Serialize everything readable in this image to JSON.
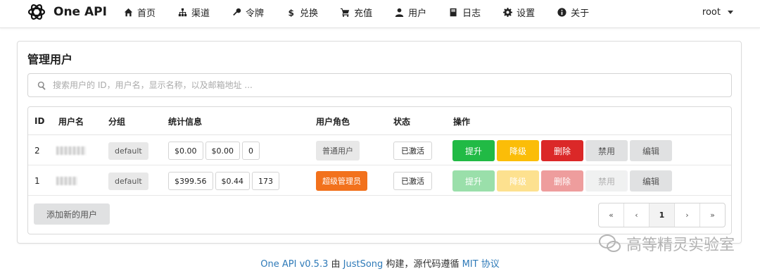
{
  "app": {
    "name": "One API"
  },
  "nav": {
    "items": [
      {
        "label": "首页",
        "icon": "home-icon"
      },
      {
        "label": "渠道",
        "icon": "sitemap-icon"
      },
      {
        "label": "令牌",
        "icon": "key-icon"
      },
      {
        "label": "兑换",
        "icon": "dollar-icon"
      },
      {
        "label": "充值",
        "icon": "cart-icon"
      },
      {
        "label": "用户",
        "icon": "user-icon"
      },
      {
        "label": "日志",
        "icon": "book-icon"
      },
      {
        "label": "设置",
        "icon": "gear-icon"
      },
      {
        "label": "关于",
        "icon": "info-icon"
      }
    ],
    "user": "root"
  },
  "page": {
    "title": "管理用户",
    "search_placeholder": "搜索用户的 ID，用户名，显示名称，以及邮箱地址 ..."
  },
  "table": {
    "headers": [
      "ID",
      "用户名",
      "分组",
      "统计信息",
      "用户角色",
      "状态",
      "操作"
    ],
    "rows": [
      {
        "id": "2",
        "group": "default",
        "stats": [
          "$0.00",
          "$0.00",
          "0"
        ],
        "role": "普通用户",
        "status": "已激活",
        "actions": [
          "提升",
          "降级",
          "删除",
          "禁用",
          "编辑"
        ]
      },
      {
        "id": "1",
        "group": "default",
        "stats": [
          "$399.56",
          "$0.44",
          "173"
        ],
        "role": "超级管理员",
        "status": "已激活",
        "actions": [
          "提升",
          "降级",
          "删除",
          "禁用",
          "编辑"
        ]
      }
    ],
    "add_button": "添加新的用户",
    "pagination": [
      "«",
      "‹",
      "1",
      "›",
      "»"
    ]
  },
  "footer": {
    "version": "One API v0.5.3",
    "by": "由",
    "author": "JustSong",
    "built": "构建，源代码遵循",
    "license": "MIT 协议"
  },
  "watermark": {
    "text": "高等精灵实验室"
  },
  "colors": {
    "promote": "#21ba45",
    "demote": "#fbbd08",
    "delete": "#db2828",
    "admin_role": "#f2711c",
    "link": "#2e7ab8"
  }
}
